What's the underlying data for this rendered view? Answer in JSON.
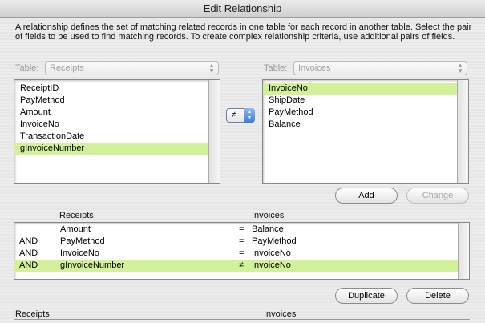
{
  "window": {
    "title": "Edit Relationship"
  },
  "description": "A relationship defines the set of matching related records in one table for each record in another table. Select the pair of fields to be used to find matching records. To create complex relationship criteria, use additional pairs of fields.",
  "left_table": {
    "label": "Table:",
    "selected": "Receipts",
    "fields": [
      "ReceiptID",
      "PayMethod",
      "Amount",
      "InvoiceNo",
      "TransactionDate",
      "gInvoiceNumber"
    ],
    "selected_index": 5
  },
  "right_table": {
    "label": "Table:",
    "selected": "Invoices",
    "fields": [
      "InvoiceNo",
      "ShipDate",
      "PayMethod",
      "Balance"
    ],
    "selected_index": 0
  },
  "operator": {
    "value": "≠"
  },
  "buttons": {
    "add": "Add",
    "change": "Change",
    "duplicate": "Duplicate",
    "delete": "Delete"
  },
  "criteria": {
    "left_header": "Receipts",
    "right_header": "Invoices",
    "rows": [
      {
        "conj": "",
        "left": "Amount",
        "op": "=",
        "right": "Balance",
        "selected": false
      },
      {
        "conj": "AND",
        "left": "PayMethod",
        "op": "=",
        "right": "PayMethod",
        "selected": false
      },
      {
        "conj": "AND",
        "left": "InvoiceNo",
        "op": "=",
        "right": "InvoiceNo",
        "selected": false
      },
      {
        "conj": "AND",
        "left": "gInvoiceNumber",
        "op": "≠",
        "right": "InvoiceNo",
        "selected": true
      }
    ]
  },
  "options": {
    "left_header": "Receipts",
    "right_header": "Invoices"
  },
  "colors": {
    "selection": "#d3f09a",
    "stepper": "#3d7de0"
  }
}
